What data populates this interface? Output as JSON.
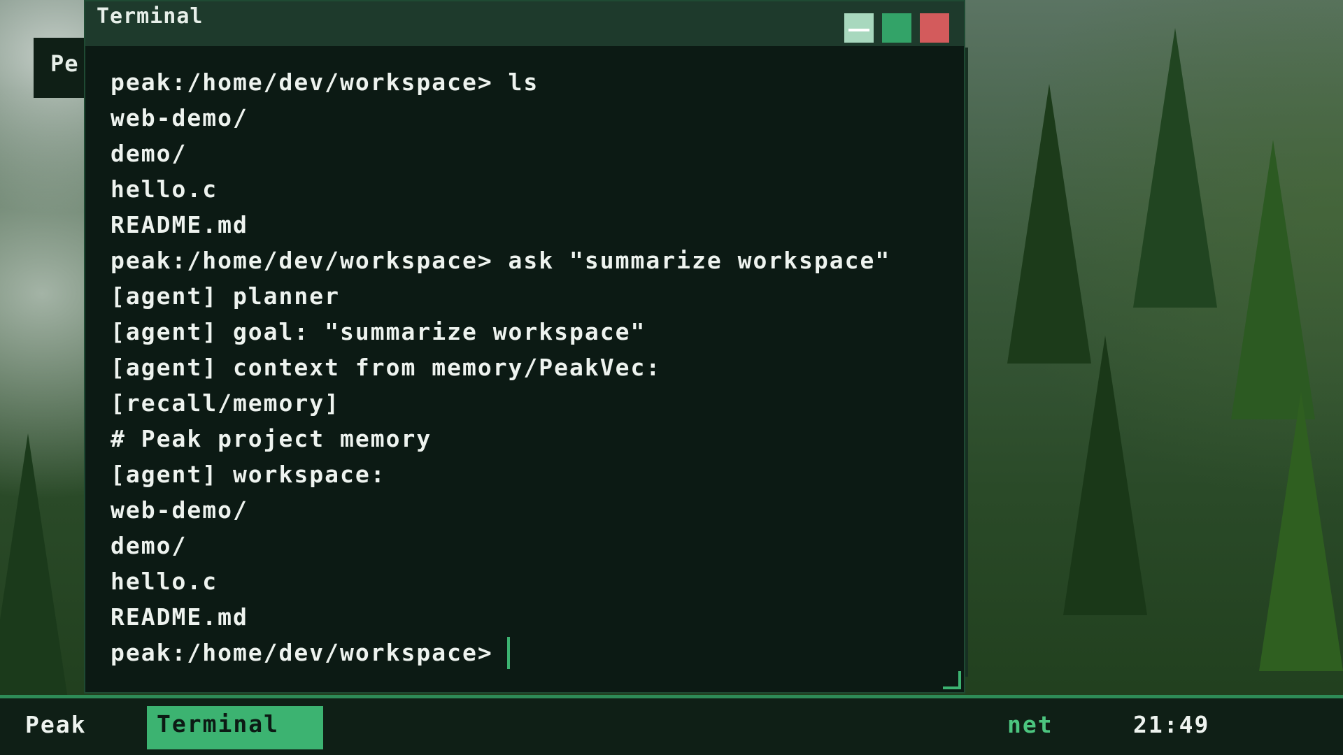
{
  "colors": {
    "accent": "#3cb371",
    "terminal_bg": "#0c1a14",
    "titlebar_bg": "#1e3a2c",
    "taskbar_bg": "#0f1f16",
    "close": "#d35b5c",
    "minimize": "#a8d8be",
    "maximize": "#33a368"
  },
  "background_window": {
    "title_fragment": "Pe"
  },
  "terminal": {
    "title": "Terminal",
    "buttons": {
      "minimize": "minimize-icon",
      "maximize": "maximize-icon",
      "close": "close-icon"
    },
    "lines": [
      "peak:/home/dev/workspace> ls",
      "web-demo/",
      "demo/",
      "hello.c",
      "README.md",
      "peak:/home/dev/workspace> ask \"summarize workspace\"",
      "[agent] planner",
      "[agent] goal: \"summarize workspace\"",
      "[agent] context from memory/PeakVec:",
      "[recall/memory]",
      "# Peak project memory",
      "[agent] workspace:",
      "web-demo/",
      "demo/",
      "hello.c",
      "README.md"
    ],
    "prompt": "peak:/home/dev/workspace>"
  },
  "taskbar": {
    "brand": "Peak",
    "active_app": "Terminal",
    "network": "net",
    "clock": "21:49"
  }
}
